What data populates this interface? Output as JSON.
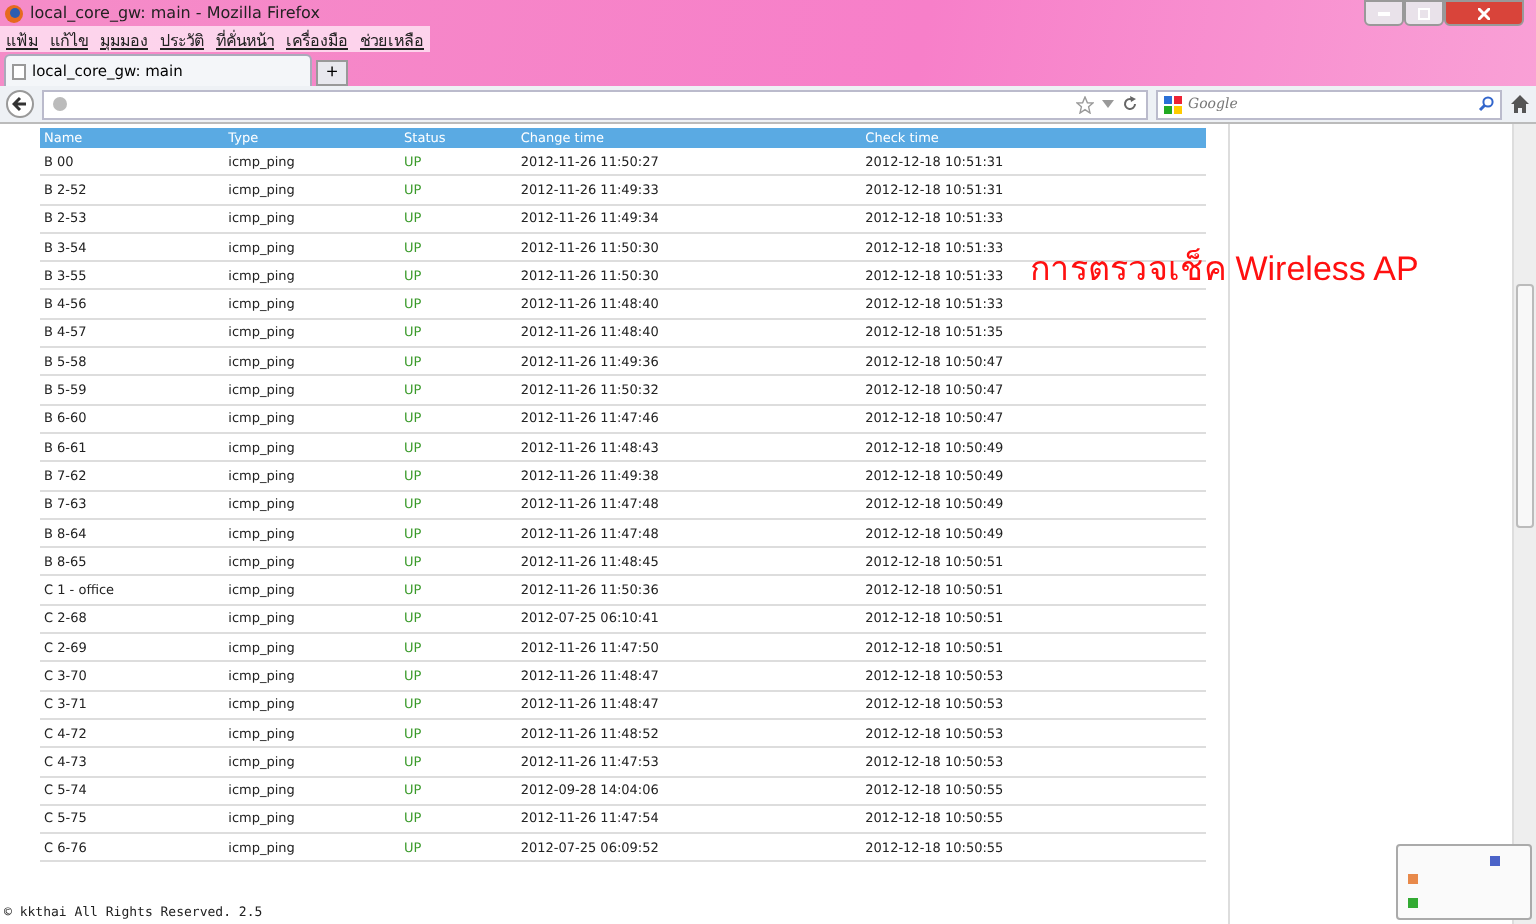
{
  "window": {
    "title": "local_core_gw: main - Mozilla Firefox"
  },
  "menu": [
    "แฟ้ม",
    "แก้ไข",
    "มุมมอง",
    "ประวัติ",
    "ที่คั่นหน้า",
    "เครื่องมือ",
    "ช่วยเหลือ"
  ],
  "tabs": [
    {
      "label": "local_core_gw: main",
      "selected": true
    }
  ],
  "new_tab": "+",
  "search": {
    "placeholder": "Google"
  },
  "table": {
    "columns": [
      "Name",
      "Type",
      "Status",
      "Change time",
      "Check time"
    ],
    "rows": [
      [
        "B 00",
        "icmp_ping",
        "UP",
        "2012-11-26 11:50:27",
        "2012-12-18 10:51:31"
      ],
      [
        "B 2-52",
        "icmp_ping",
        "UP",
        "2012-11-26 11:49:33",
        "2012-12-18 10:51:31"
      ],
      [
        "B 2-53",
        "icmp_ping",
        "UP",
        "2012-11-26 11:49:34",
        "2012-12-18 10:51:33"
      ],
      [
        "B 3-54",
        "icmp_ping",
        "UP",
        "2012-11-26 11:50:30",
        "2012-12-18 10:51:33"
      ],
      [
        "B 3-55",
        "icmp_ping",
        "UP",
        "2012-11-26 11:50:30",
        "2012-12-18 10:51:33"
      ],
      [
        "B 4-56",
        "icmp_ping",
        "UP",
        "2012-11-26 11:48:40",
        "2012-12-18 10:51:33"
      ],
      [
        "B 4-57",
        "icmp_ping",
        "UP",
        "2012-11-26 11:48:40",
        "2012-12-18 10:51:35"
      ],
      [
        "B 5-58",
        "icmp_ping",
        "UP",
        "2012-11-26 11:49:36",
        "2012-12-18 10:50:47"
      ],
      [
        "B 5-59",
        "icmp_ping",
        "UP",
        "2012-11-26 11:50:32",
        "2012-12-18 10:50:47"
      ],
      [
        "B 6-60",
        "icmp_ping",
        "UP",
        "2012-11-26 11:47:46",
        "2012-12-18 10:50:47"
      ],
      [
        "B 6-61",
        "icmp_ping",
        "UP",
        "2012-11-26 11:48:43",
        "2012-12-18 10:50:49"
      ],
      [
        "B 7-62",
        "icmp_ping",
        "UP",
        "2012-11-26 11:49:38",
        "2012-12-18 10:50:49"
      ],
      [
        "B 7-63",
        "icmp_ping",
        "UP",
        "2012-11-26 11:47:48",
        "2012-12-18 10:50:49"
      ],
      [
        "B 8-64",
        "icmp_ping",
        "UP",
        "2012-11-26 11:47:48",
        "2012-12-18 10:50:49"
      ],
      [
        "B 8-65",
        "icmp_ping",
        "UP",
        "2012-11-26 11:48:45",
        "2012-12-18 10:50:51"
      ],
      [
        "C 1 - office",
        "icmp_ping",
        "UP",
        "2012-11-26 11:50:36",
        "2012-12-18 10:50:51"
      ],
      [
        "C 2-68",
        "icmp_ping",
        "UP",
        "2012-07-25 06:10:41",
        "2012-12-18 10:50:51"
      ],
      [
        "C 2-69",
        "icmp_ping",
        "UP",
        "2012-11-26 11:47:50",
        "2012-12-18 10:50:51"
      ],
      [
        "C 3-70",
        "icmp_ping",
        "UP",
        "2012-11-26 11:48:47",
        "2012-12-18 10:50:53"
      ],
      [
        "C 3-71",
        "icmp_ping",
        "UP",
        "2012-11-26 11:48:47",
        "2012-12-18 10:50:53"
      ],
      [
        "C 4-72",
        "icmp_ping",
        "UP",
        "2012-11-26 11:48:52",
        "2012-12-18 10:50:53"
      ],
      [
        "C 4-73",
        "icmp_ping",
        "UP",
        "2012-11-26 11:47:53",
        "2012-12-18 10:50:53"
      ],
      [
        "C 5-74",
        "icmp_ping",
        "UP",
        "2012-09-28 14:04:06",
        "2012-12-18 10:50:55"
      ],
      [
        "C 5-75",
        "icmp_ping",
        "UP",
        "2012-11-26 11:47:54",
        "2012-12-18 10:50:55"
      ],
      [
        "C 6-76",
        "icmp_ping",
        "UP",
        "2012-07-25 06:09:52",
        "2012-12-18 10:50:55"
      ]
    ]
  },
  "caption": "การตรวจเช็ค Wireless AP",
  "footer": "© kkthai All Rights Reserved. 2.5"
}
